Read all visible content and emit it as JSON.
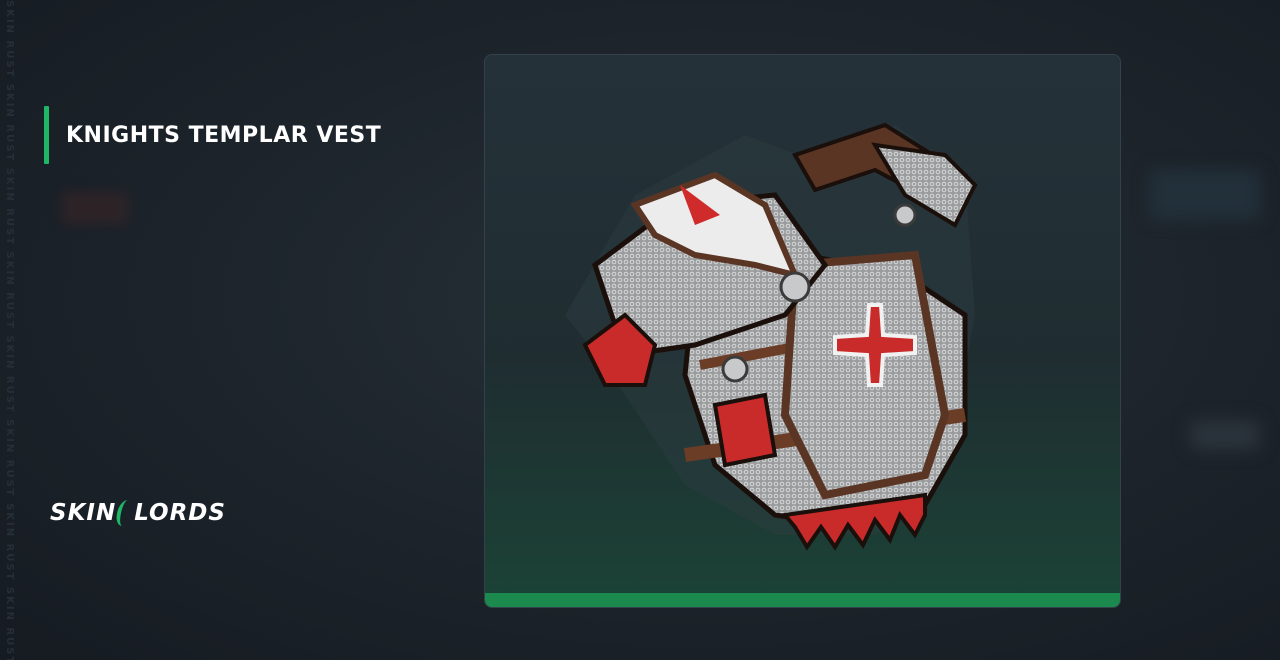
{
  "item": {
    "name": "KNIGHTS TEMPLAR VEST"
  },
  "brand": {
    "logo_text_left": "SKIN",
    "logo_text_right": "LORDS",
    "logo_icon": "skinlords-logo-icon"
  },
  "watermark": {
    "text": "SKIN RUST SKIN RUST SKIN RUST SKIN RUST SKIN RUST SKIN RUST SKIN RUST SKIN RUST"
  },
  "colors": {
    "accent": "#1fb665",
    "card_bottom": "#1c8a4e",
    "background": "#1c232a"
  },
  "icons": {
    "item_image": "chainmail-vest-icon"
  }
}
